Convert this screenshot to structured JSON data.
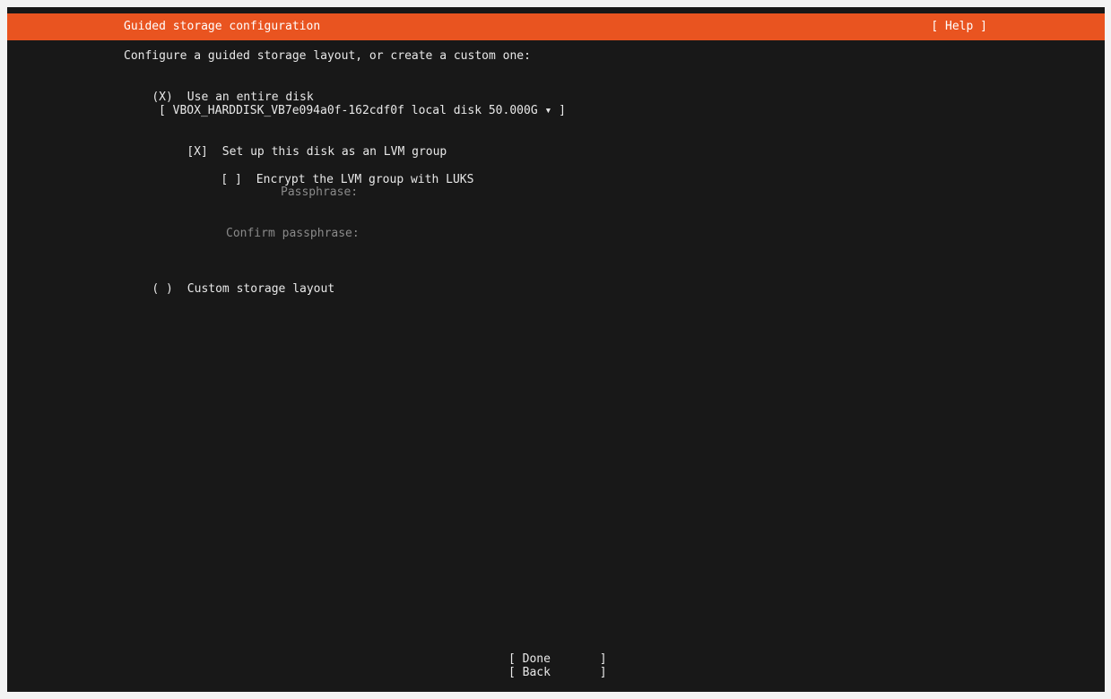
{
  "header": {
    "title": "Guided storage configuration",
    "help_label": "[ Help ]"
  },
  "main": {
    "intro": "Configure a guided storage layout, or create a custom one:",
    "use_entire_disk": {
      "mark": "(X)",
      "label": "Use an entire disk"
    },
    "disk_select": {
      "value": "[ VBOX_HARDDISK_VB7e094a0f-162cdf0f local disk 50.000G ▾ ]"
    },
    "lvm_group": {
      "mark": "[X]",
      "label": "Set up this disk as an LVM group"
    },
    "encrypt_luks": {
      "mark": "[ ]",
      "label": "Encrypt the LVM group with LUKS"
    },
    "passphrase_label": "Passphrase:",
    "confirm_passphrase_label": "Confirm passphrase:",
    "custom_layout": {
      "mark": "( )",
      "label": "Custom storage layout"
    }
  },
  "footer": {
    "done_label": "[ Done       ]",
    "back_label": "[ Back       ]"
  },
  "colors": {
    "accent": "#e95420",
    "background": "#181818",
    "text": "#e8e8e8",
    "dimmed_text": "#8a8a8a"
  }
}
